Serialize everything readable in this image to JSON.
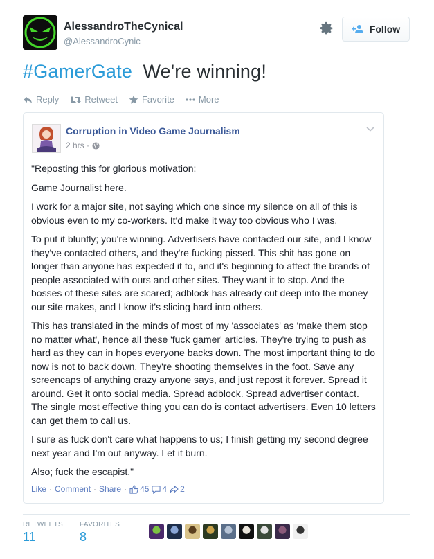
{
  "profile": {
    "name": "AlessandroTheCynical",
    "handle": "@AlessandroCynic",
    "follow_label": "Follow"
  },
  "tweet": {
    "hashtag": "#GamerGate",
    "text": "We're winning!"
  },
  "actions": {
    "reply": "Reply",
    "retweet": "Retweet",
    "favorite": "Favorite",
    "more": "More"
  },
  "embedded_post": {
    "page_name": "Corruption in Video Game Journalism",
    "time": "2 hrs ·",
    "paragraphs": [
      "\"Reposting this for glorious motivation:",
      "Game Journalist here.",
      "I work for a major site, not saying which one since my silence on all of this is obvious even to my co-workers. It'd make it way too obvious who I was.",
      "To put it bluntly; you're winning. Advertisers have contacted our site, and I know they've contacted others, and they're fucking pissed. This shit has gone on longer than anyone has expected it to, and it's beginning to affect the brands of people associated with ours and other sites. They want it to stop. And the bosses of these sites are scared; adblock has already cut deep into the money our site makes, and I know it's slicing hard into others.",
      "This has translated in the minds of most of my 'associates' as 'make them stop no matter what', hence all these 'fuck gamer' articles. They're trying to push as hard as they can in hopes everyone backs down. The most important thing to do now is not to back down. They're shooting themselves in the foot. Save any screencaps of anything crazy anyone says, and just repost it forever. Spread it around. Get it onto social media. Spread adblock. Spread advertiser contact. The single most effective thing you can do is contact advertisers. Even 10 letters can get them to call us.",
      "I sure as fuck don't care what happens to us; I finish getting my second degree next year and I'm out anyway. Let it burn.",
      "Also; fuck the escapist.\""
    ],
    "actions": {
      "like": "Like",
      "comment": "Comment",
      "share": "Share",
      "likes_count": "45",
      "comments_count": "4",
      "shares_count": "2"
    }
  },
  "stats": {
    "retweets_label": "RETWEETS",
    "retweets_value": "11",
    "favorites_label": "FAVORITES",
    "favorites_value": "8"
  },
  "likers": [
    {
      "color": "#4b2a6b",
      "accent": "#7cc242",
      "icon": "avatar-liker-icon"
    },
    {
      "color": "#1e2e4a",
      "accent": "#8aa6d6",
      "icon": "avatar-liker-icon"
    },
    {
      "color": "#d9c38a",
      "accent": "#5a3e1e",
      "icon": "avatar-liker-icon"
    },
    {
      "color": "#2c3a22",
      "accent": "#c9a24a",
      "icon": "avatar-liker-icon"
    },
    {
      "color": "#5b6f8a",
      "accent": "#b7c4d6",
      "icon": "avatar-liker-icon"
    },
    {
      "color": "#111111",
      "accent": "#e9e4da",
      "icon": "avatar-liker-icon"
    },
    {
      "color": "#3b4a3a",
      "accent": "#e3e3e3",
      "icon": "avatar-liker-icon"
    },
    {
      "color": "#3a2a4a",
      "accent": "#8b5a7a",
      "icon": "avatar-liker-icon"
    },
    {
      "color": "#f0f0f0",
      "accent": "#333333",
      "icon": "avatar-liker-icon"
    }
  ],
  "colors": {
    "link_blue": "#2b9bd8",
    "facebook_blue": "#3b5998",
    "muted": "#8899a6"
  }
}
